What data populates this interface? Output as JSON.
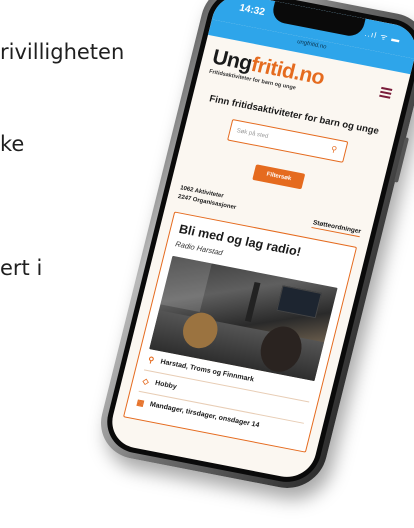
{
  "background_text": [
    "rivilligheten",
    "ke",
    "ert i"
  ],
  "phone": {
    "status": {
      "time": "14:32",
      "icons": "..ıl ᯤ ▬"
    },
    "url": "ungfritid.no"
  },
  "site": {
    "logo": {
      "part1": "Ung",
      "part2": "fritid.no"
    },
    "tagline": "Fritidsaktiviteter for barn og unge",
    "search": {
      "title": "Finn fritidsaktiviteter for barn og unge",
      "placeholder": "Søk på sted",
      "button": "Filtersøk"
    },
    "stats": {
      "activities": "1062 Aktiviteter",
      "organizations": "2247 Organisasjoner",
      "support_link": "Støtteordninger"
    },
    "card": {
      "title": "Bli med og lag radio!",
      "organization": "Radio Harstad",
      "location": "Harstad, Troms og Finnmark",
      "category": "Hobby",
      "schedule": "Mandager, tirsdager, onsdager 14"
    }
  },
  "colors": {
    "accent": "#e56b1f",
    "status_bar": "#2ea5ea",
    "menu": "#7a1c3a"
  },
  "icons": {
    "menu": "hamburger-icon",
    "location": "map-pin-icon",
    "category": "tag-icon",
    "schedule": "calendar-icon"
  }
}
